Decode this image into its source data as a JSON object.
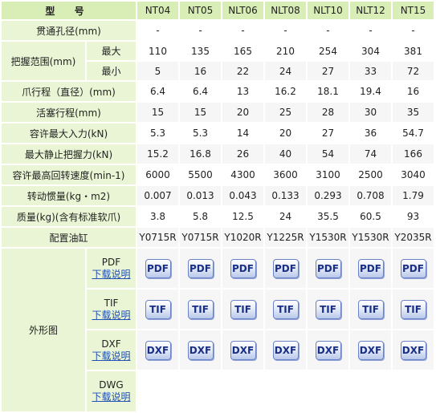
{
  "header": {
    "type_label": "型 号",
    "models": [
      "NT04",
      "NT05",
      "NLT06",
      "NLT08",
      "NLT10",
      "NLT12",
      "NT15"
    ]
  },
  "rows": {
    "bore": {
      "label": "贯通孔径(mm)",
      "values": [
        "-",
        "-",
        "-",
        "-",
        "-",
        "-",
        "-"
      ]
    },
    "grip_range": {
      "label": "把握范围(mm)",
      "max": {
        "label": "最大",
        "values": [
          "110",
          "135",
          "165",
          "210",
          "254",
          "304",
          "381"
        ]
      },
      "min": {
        "label": "最小",
        "values": [
          "5",
          "16",
          "22",
          "24",
          "27",
          "33",
          "72"
        ]
      }
    },
    "jaw_stroke": {
      "label": "爪行程（直径）(mm)",
      "values": [
        "6.4",
        "6.4",
        "13",
        "16.2",
        "18.1",
        "19.4",
        "16"
      ]
    },
    "piston_stroke": {
      "label": "活塞行程(mm)",
      "values": [
        "15",
        "15",
        "20",
        "25",
        "28",
        "30",
        "35"
      ]
    },
    "max_input": {
      "label": "容许最大入力(kN)",
      "values": [
        "5.3",
        "5.3",
        "14",
        "20",
        "27",
        "36",
        "54.7"
      ]
    },
    "max_grip": {
      "label": "最大静止把握力(kN)",
      "values": [
        "15.2",
        "16.8",
        "26",
        "40",
        "54",
        "74",
        "166"
      ]
    },
    "max_speed": {
      "label": "容许最高回转速度(min-1)",
      "values": [
        "6000",
        "5500",
        "4300",
        "3600",
        "3100",
        "2500",
        "3040"
      ]
    },
    "inertia": {
      "label": "转动惯量(kg・m2)",
      "values": [
        "0.007",
        "0.013",
        "0.043",
        "0.133",
        "0.293",
        "0.708",
        "1.79"
      ]
    },
    "mass": {
      "label": "质量(kg)(含有标准软爪)",
      "values": [
        "3.8",
        "5.8",
        "12.5",
        "24",
        "35.5",
        "60.5",
        "93"
      ]
    },
    "cylinder": {
      "label": "配置油缸",
      "values": [
        "Y0715R",
        "Y0715R",
        "Y1020R",
        "Y1225R",
        "Y1530R",
        "Y1530R",
        "Y2035R"
      ]
    }
  },
  "drawings": {
    "label": "外形图",
    "link_text": "下载说明",
    "formats": [
      {
        "name": "PDF",
        "icon": "PDF",
        "has_files": true
      },
      {
        "name": "TIF",
        "icon": "TIF",
        "has_files": true
      },
      {
        "name": "DXF",
        "icon": "DXF",
        "has_files": true
      },
      {
        "name": "DWG",
        "icon": "DWG",
        "has_files": false
      }
    ]
  },
  "colors": {
    "header_bg": "#d9eeb7",
    "label_bg": "#e9f5d4",
    "cell_bg": "#f6f6f6",
    "label_text": "#1a3c6e",
    "link": "#2050b8",
    "icon_border": "#6c82c6"
  }
}
